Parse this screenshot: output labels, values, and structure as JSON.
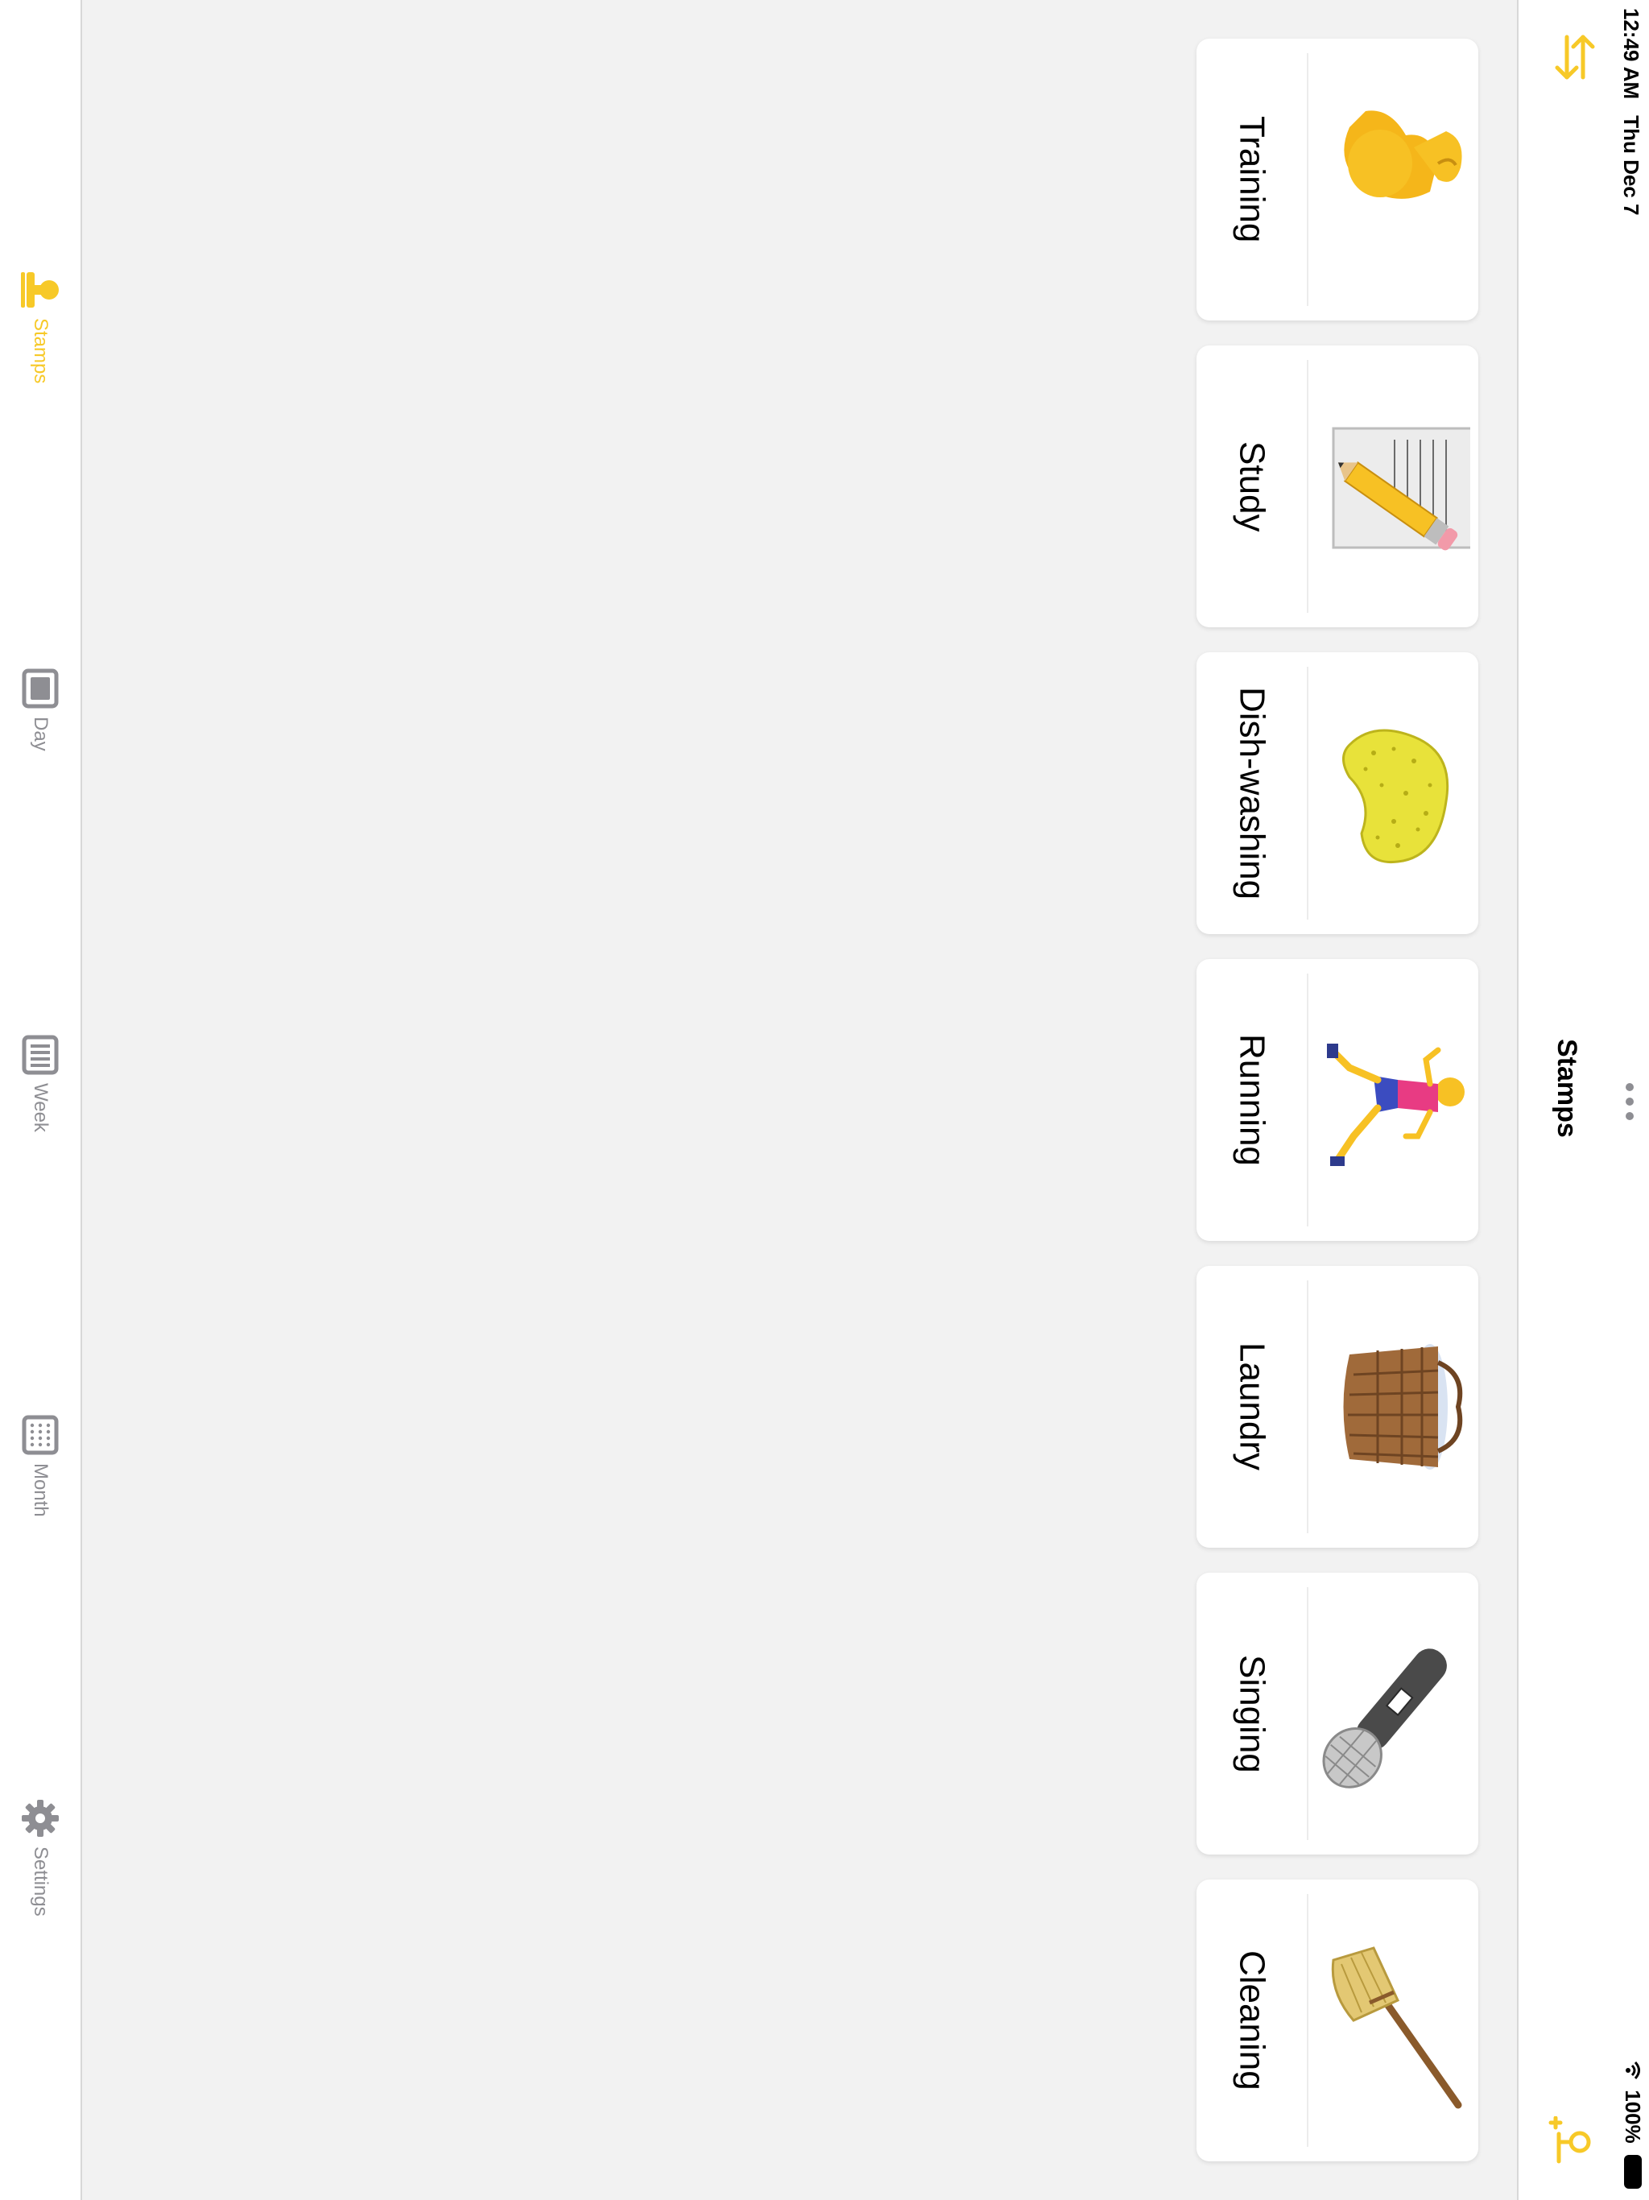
{
  "status_bar": {
    "time": "12:49 AM",
    "date": "Thu Dec 7",
    "battery": "100%"
  },
  "nav": {
    "title": "Stamps",
    "swap_icon": "arrows-swap-icon",
    "more_icon": "ellipsis-icon",
    "add_icon": "add-stamp-icon"
  },
  "tabs": [
    {
      "label": "Stamps",
      "icon": "stamp-icon",
      "active": true
    },
    {
      "label": "Day",
      "icon": "day-icon",
      "active": false
    },
    {
      "label": "Week",
      "icon": "week-icon",
      "active": false
    },
    {
      "label": "Month",
      "icon": "month-icon",
      "active": false
    },
    {
      "label": "Settings",
      "icon": "gear-icon",
      "active": false
    }
  ],
  "stamps": [
    {
      "label": "Training",
      "icon": "flexed-biceps-icon"
    },
    {
      "label": "Study",
      "icon": "memo-pencil-icon"
    },
    {
      "label": "Dish-washing",
      "icon": "sponge-icon"
    },
    {
      "label": "Running",
      "icon": "runner-icon"
    },
    {
      "label": "Laundry",
      "icon": "basket-icon"
    },
    {
      "label": "Singing",
      "icon": "microphone-icon"
    },
    {
      "label": "Cleaning",
      "icon": "broom-icon"
    }
  ],
  "colors": {
    "accent": "#f7c928",
    "inactive": "#8e8e93",
    "background": "#f2f2f2"
  }
}
